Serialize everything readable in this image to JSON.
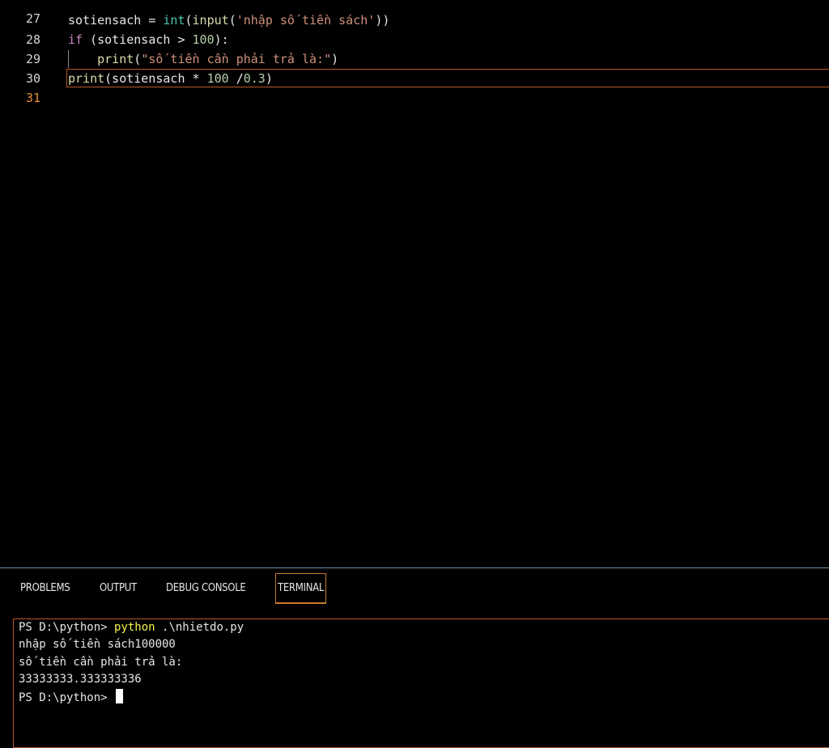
{
  "editor": {
    "top_line_number": "27",
    "lines": [
      {
        "number": "28",
        "tokens": [
          "sotiensach",
          " = ",
          "int",
          "(",
          "input",
          "(",
          "'nhập số tiền sách'",
          "))"
        ]
      },
      {
        "number": "29",
        "tokens": [
          "if",
          " (sotiensach ",
          ">",
          " ",
          "100",
          "):"
        ]
      },
      {
        "number": "30",
        "tokens": [
          "    ",
          "print",
          "(",
          "\"số tiền cần phải trả là:\"",
          ")"
        ]
      },
      {
        "number": "31",
        "tokens": [
          "print",
          "(sotiensach ",
          "*",
          " ",
          "100",
          " /",
          "0.3",
          ")"
        ]
      }
    ]
  },
  "panel": {
    "tabs": [
      {
        "label": "PROBLEMS",
        "active": false
      },
      {
        "label": "OUTPUT",
        "active": false
      },
      {
        "label": "DEBUG CONSOLE",
        "active": false
      },
      {
        "label": "TERMINAL",
        "active": true
      }
    ]
  },
  "terminal": {
    "prompt": "PS D:\\python> ",
    "command": "python",
    "command_args": " .\\nhietdo.py",
    "output_lines": [
      "nhập số tiền sách100000",
      "số tiền cần phải trả là:",
      "33333333.333333336"
    ],
    "final_prompt": "PS D:\\python> "
  },
  "colors": {
    "background": "#000000",
    "active_line_number": "#e8903a",
    "keyword": "#c586c0",
    "builtin": "#4ec9b0",
    "function": "#dcdcaa",
    "string": "#ce9178",
    "number": "#b5cea8",
    "terminal_command": "#f3f34a",
    "focus_border": "#b6582a"
  }
}
